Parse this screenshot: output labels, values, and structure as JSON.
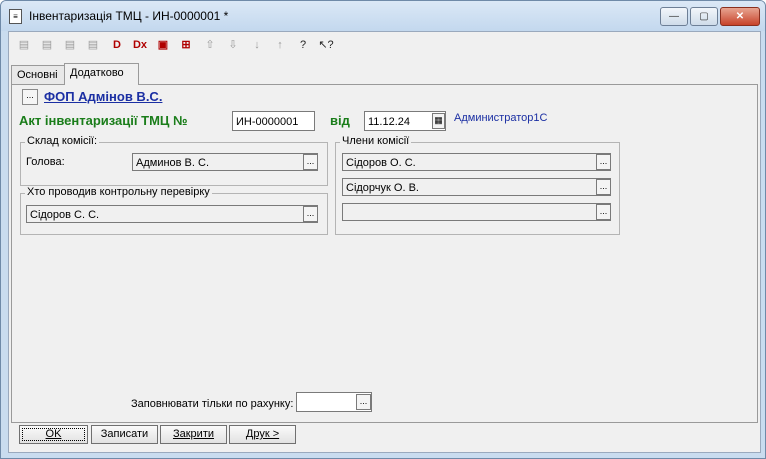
{
  "window": {
    "title": "Інвентаризація ТМЦ - ИН-0000001 *",
    "min_label": "—",
    "max_label": "▢",
    "close_label": "✕"
  },
  "tabs": [
    {
      "label": "Основні"
    },
    {
      "label": "Додатково"
    }
  ],
  "header": {
    "org_name": "ФОП Адмінов В.С.",
    "doc_title": "Акт інвентаризації ТМЦ №",
    "doc_number": "ИН-0000001",
    "date_label": "від",
    "date_value": "11.12.24",
    "author": "Администратор1С"
  },
  "commission": {
    "group_label": "Склад комісії:",
    "head_label": "Голова:",
    "head_value": "Админов В. С."
  },
  "inspector": {
    "group_label": "Хто проводив контрольну перевірку",
    "value": "Сідоров С. С."
  },
  "members": {
    "group_label": "Члени комісії",
    "items": [
      "Сідоров О. С.",
      "Сідорчук О. В.",
      ""
    ]
  },
  "account": {
    "label": "Заповнювати тільки по рахунку:",
    "value": ""
  },
  "buttons": {
    "ok": "OK",
    "save": "Записати",
    "close": "Закрити",
    "print": "Друк >"
  },
  "icons": [
    "add-row-icon",
    "copy-row-icon",
    "edit-row-icon",
    "delete-row-icon",
    "mark-delete-icon",
    "end-edit-icon",
    "fill-icon",
    "select-icon",
    "move-up-icon",
    "move-down-icon",
    "sort-asc-icon",
    "sort-desc-icon",
    "help-icon",
    "whats-this-icon"
  ]
}
